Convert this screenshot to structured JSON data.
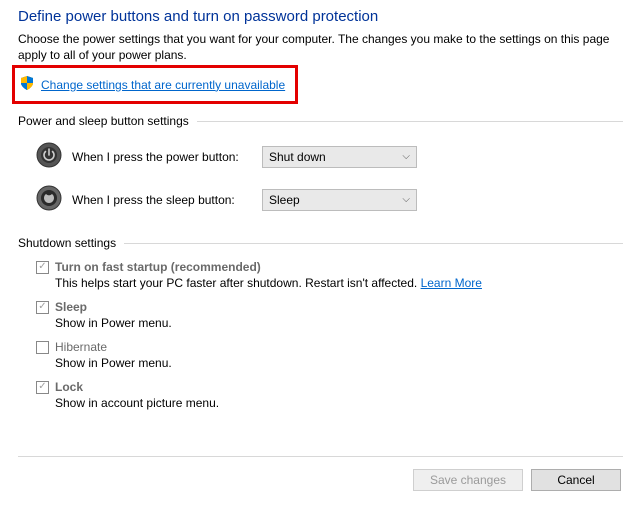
{
  "title": "Define power buttons and turn on password protection",
  "description": "Choose the power settings that you want for your computer. The changes you make to the settings on this page apply to all of your power plans.",
  "change_link": "Change settings that are currently unavailable",
  "sections": {
    "button_settings": {
      "header": "Power and sleep button settings",
      "power_label": "When I press the power button:",
      "power_value": "Shut down",
      "sleep_label": "When I press the sleep button:",
      "sleep_value": "Sleep"
    },
    "shutdown": {
      "header": "Shutdown settings",
      "items": [
        {
          "label": "Turn on fast startup (recommended)",
          "bold": true,
          "checked": true,
          "sub": "This helps start your PC faster after shutdown. Restart isn't affected. ",
          "learn_more": "Learn More"
        },
        {
          "label": "Sleep",
          "bold": true,
          "checked": true,
          "sub": "Show in Power menu."
        },
        {
          "label": "Hibernate",
          "bold": false,
          "checked": false,
          "sub": "Show in Power menu."
        },
        {
          "label": "Lock",
          "bold": true,
          "checked": true,
          "sub": "Show in account picture menu."
        }
      ]
    }
  },
  "footer": {
    "save": "Save changes",
    "cancel": "Cancel"
  }
}
